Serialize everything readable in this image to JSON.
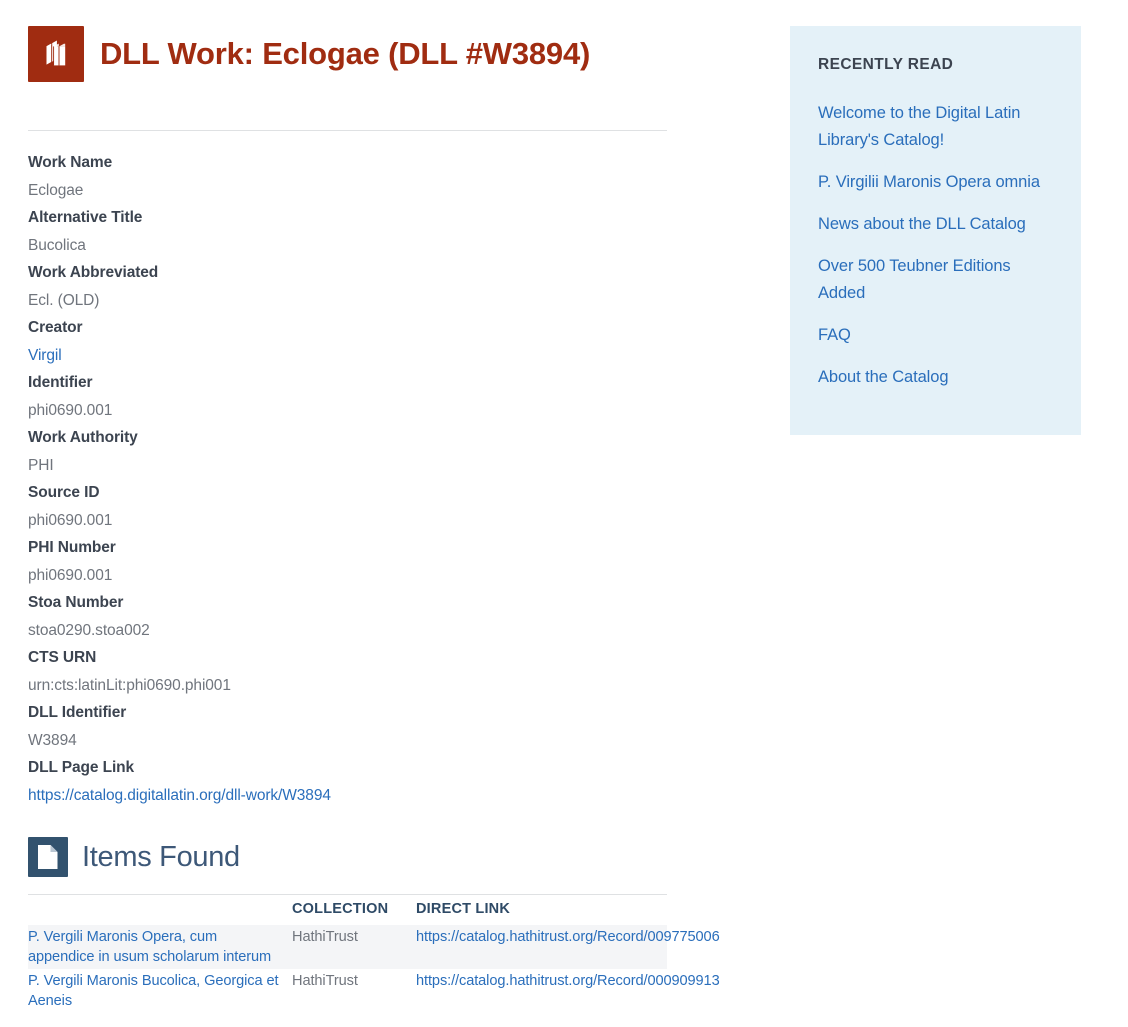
{
  "work": {
    "icon": "books-icon",
    "title": "DLL Work: Eclogae (DLL #W3894)",
    "fields": [
      {
        "label": "Work Name",
        "value": "Eclogae",
        "is_link": false
      },
      {
        "label": "Alternative Title",
        "value": "Bucolica",
        "is_link": false
      },
      {
        "label": "Work Abbreviated",
        "value": "Ecl. (OLD)",
        "is_link": false
      },
      {
        "label": "Creator",
        "value": "Virgil",
        "is_link": true
      },
      {
        "label": "Identifier",
        "value": "phi0690.001",
        "is_link": false
      },
      {
        "label": "Work Authority",
        "value": "PHI",
        "is_link": false
      },
      {
        "label": "Source ID",
        "value": "phi0690.001",
        "is_link": false
      },
      {
        "label": "PHI Number",
        "value": "phi0690.001",
        "is_link": false
      },
      {
        "label": "Stoa Number",
        "value": "stoa0290.stoa002",
        "is_link": false
      },
      {
        "label": "CTS URN",
        "value": "urn:cts:latinLit:phi0690.phi001",
        "is_link": false
      },
      {
        "label": "DLL Identifier",
        "value": "W3894",
        "is_link": false
      },
      {
        "label": "DLL Page Link",
        "value": "https://catalog.digitallatin.org/dll-work/W3894",
        "is_link": true
      }
    ]
  },
  "items": {
    "icon": "document-icon",
    "heading": "Items Found",
    "columns": [
      "",
      "COLLECTION",
      "DIRECT LINK"
    ],
    "rows": [
      {
        "title": "P. Vergili Maronis Opera, cum appendice in usum scholarum interum",
        "collection": "HathiTrust",
        "link": "https://catalog.hathitrust.org/Record/009775006"
      },
      {
        "title": "P. Vergili Maronis Bucolica, Georgica et Aeneis",
        "collection": "HathiTrust",
        "link": "https://catalog.hathitrust.org/Record/000909913"
      }
    ]
  },
  "sidebar": {
    "title": "RECENTLY READ",
    "links": [
      "Welcome to the Digital Latin Library's Catalog!",
      "P. Virgilii Maronis Opera omnia",
      "News about the DLL Catalog",
      "Over 500 Teubner Editions Added",
      "FAQ",
      "About the Catalog"
    ]
  },
  "colors": {
    "brand_red": "#a02c11",
    "link_blue": "#2a6ebb",
    "navy": "#32526e",
    "sidebar_bg": "#e4f1f8",
    "row_stripe": "#f4f5f7"
  }
}
